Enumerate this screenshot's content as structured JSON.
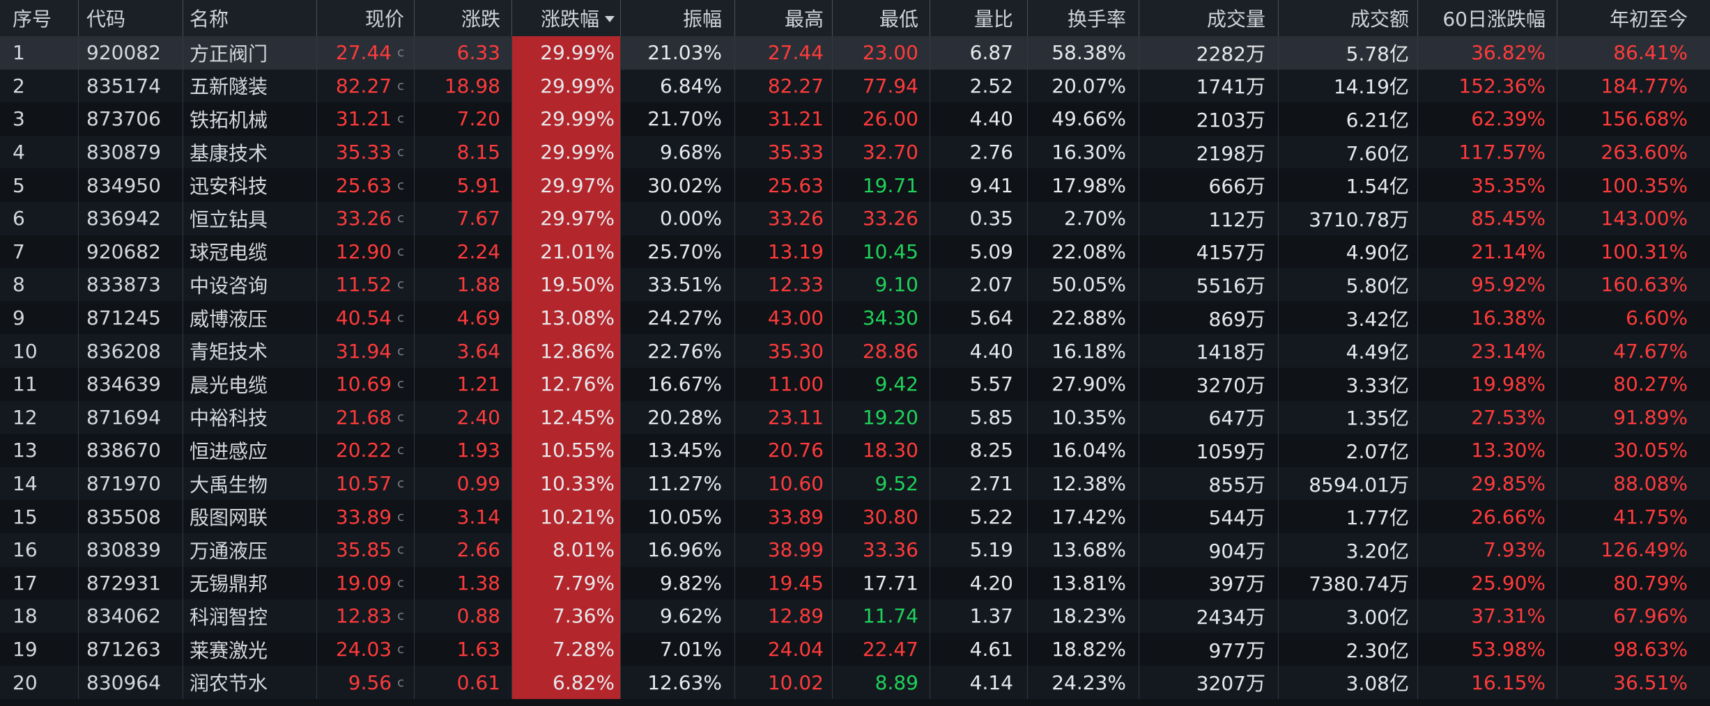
{
  "headers": {
    "seq": "序号",
    "code": "代码",
    "name": "名称",
    "price": "现价",
    "chg": "涨跌",
    "chg_pct": "涨跌幅",
    "amp": "振幅",
    "high": "最高",
    "low": "最低",
    "vol_ratio": "量比",
    "turnover": "换手率",
    "volume": "成交量",
    "amount": "成交额",
    "chg60": "60日涨跌幅",
    "ytd": "年初至今"
  },
  "price_suffix": "c",
  "colors": {
    "up": "#ff3b3b",
    "down": "#1fd35a",
    "neutral": "#e7e9ec",
    "pct_bg": "#b3262c"
  },
  "rows": [
    {
      "seq": "1",
      "code": "920082",
      "name": "方正阀门",
      "price": "27.44",
      "chg": "6.33",
      "chg_pct": "29.99%",
      "amp": "21.03%",
      "high": "27.44",
      "low": "23.00",
      "low_color": "red",
      "vol_ratio": "6.87",
      "turnover": "58.38%",
      "volume": "2282万",
      "amount": "5.78亿",
      "chg60": "36.82%",
      "ytd": "86.41%"
    },
    {
      "seq": "2",
      "code": "835174",
      "name": "五新隧装",
      "price": "82.27",
      "chg": "18.98",
      "chg_pct": "29.99%",
      "amp": "6.84%",
      "high": "82.27",
      "low": "77.94",
      "low_color": "red",
      "vol_ratio": "2.52",
      "turnover": "20.07%",
      "volume": "1741万",
      "amount": "14.19亿",
      "chg60": "152.36%",
      "ytd": "184.77%"
    },
    {
      "seq": "3",
      "code": "873706",
      "name": "铁拓机械",
      "price": "31.21",
      "chg": "7.20",
      "chg_pct": "29.99%",
      "amp": "21.70%",
      "high": "31.21",
      "low": "26.00",
      "low_color": "red",
      "vol_ratio": "4.40",
      "turnover": "49.66%",
      "volume": "2103万",
      "amount": "6.21亿",
      "chg60": "62.39%",
      "ytd": "156.68%"
    },
    {
      "seq": "4",
      "code": "830879",
      "name": "基康技术",
      "price": "35.33",
      "chg": "8.15",
      "chg_pct": "29.99%",
      "amp": "9.68%",
      "high": "35.33",
      "low": "32.70",
      "low_color": "red",
      "vol_ratio": "2.76",
      "turnover": "16.30%",
      "volume": "2198万",
      "amount": "7.60亿",
      "chg60": "117.57%",
      "ytd": "263.60%"
    },
    {
      "seq": "5",
      "code": "834950",
      "name": "迅安科技",
      "price": "25.63",
      "chg": "5.91",
      "chg_pct": "29.97%",
      "amp": "30.02%",
      "high": "25.63",
      "low": "19.71",
      "low_color": "green",
      "vol_ratio": "9.41",
      "turnover": "17.98%",
      "volume": "666万",
      "amount": "1.54亿",
      "chg60": "35.35%",
      "ytd": "100.35%"
    },
    {
      "seq": "6",
      "code": "836942",
      "name": "恒立钻具",
      "price": "33.26",
      "chg": "7.67",
      "chg_pct": "29.97%",
      "amp": "0.00%",
      "high": "33.26",
      "low": "33.26",
      "low_color": "red",
      "vol_ratio": "0.35",
      "turnover": "2.70%",
      "volume": "112万",
      "amount": "3710.78万",
      "chg60": "85.45%",
      "ytd": "143.00%"
    },
    {
      "seq": "7",
      "code": "920682",
      "name": "球冠电缆",
      "price": "12.90",
      "chg": "2.24",
      "chg_pct": "21.01%",
      "amp": "25.70%",
      "high": "13.19",
      "low": "10.45",
      "low_color": "green",
      "vol_ratio": "5.09",
      "turnover": "22.08%",
      "volume": "4157万",
      "amount": "4.90亿",
      "chg60": "21.14%",
      "ytd": "100.31%"
    },
    {
      "seq": "8",
      "code": "833873",
      "name": "中设咨询",
      "price": "11.52",
      "chg": "1.88",
      "chg_pct": "19.50%",
      "amp": "33.51%",
      "high": "12.33",
      "low": "9.10",
      "low_color": "green",
      "vol_ratio": "2.07",
      "turnover": "50.05%",
      "volume": "5516万",
      "amount": "5.80亿",
      "chg60": "95.92%",
      "ytd": "160.63%"
    },
    {
      "seq": "9",
      "code": "871245",
      "name": "威博液压",
      "price": "40.54",
      "chg": "4.69",
      "chg_pct": "13.08%",
      "amp": "24.27%",
      "high": "43.00",
      "low": "34.30",
      "low_color": "green",
      "vol_ratio": "5.64",
      "turnover": "22.88%",
      "volume": "869万",
      "amount": "3.42亿",
      "chg60": "16.38%",
      "ytd": "6.60%"
    },
    {
      "seq": "10",
      "code": "836208",
      "name": "青矩技术",
      "price": "31.94",
      "chg": "3.64",
      "chg_pct": "12.86%",
      "amp": "22.76%",
      "high": "35.30",
      "low": "28.86",
      "low_color": "red",
      "vol_ratio": "4.40",
      "turnover": "16.18%",
      "volume": "1418万",
      "amount": "4.49亿",
      "chg60": "23.14%",
      "ytd": "47.67%"
    },
    {
      "seq": "11",
      "code": "834639",
      "name": "晨光电缆",
      "price": "10.69",
      "chg": "1.21",
      "chg_pct": "12.76%",
      "amp": "16.67%",
      "high": "11.00",
      "low": "9.42",
      "low_color": "green",
      "vol_ratio": "5.57",
      "turnover": "27.90%",
      "volume": "3270万",
      "amount": "3.33亿",
      "chg60": "19.98%",
      "ytd": "80.27%"
    },
    {
      "seq": "12",
      "code": "871694",
      "name": "中裕科技",
      "price": "21.68",
      "chg": "2.40",
      "chg_pct": "12.45%",
      "amp": "20.28%",
      "high": "23.11",
      "low": "19.20",
      "low_color": "green",
      "vol_ratio": "5.85",
      "turnover": "10.35%",
      "volume": "647万",
      "amount": "1.35亿",
      "chg60": "27.53%",
      "ytd": "91.89%"
    },
    {
      "seq": "13",
      "code": "838670",
      "name": "恒进感应",
      "price": "20.22",
      "chg": "1.93",
      "chg_pct": "10.55%",
      "amp": "13.45%",
      "high": "20.76",
      "low": "18.30",
      "low_color": "red",
      "vol_ratio": "8.25",
      "turnover": "16.04%",
      "volume": "1059万",
      "amount": "2.07亿",
      "chg60": "13.30%",
      "ytd": "30.05%"
    },
    {
      "seq": "14",
      "code": "871970",
      "name": "大禹生物",
      "price": "10.57",
      "chg": "0.99",
      "chg_pct": "10.33%",
      "amp": "11.27%",
      "high": "10.60",
      "low": "9.52",
      "low_color": "green",
      "vol_ratio": "2.71",
      "turnover": "12.38%",
      "volume": "855万",
      "amount": "8594.01万",
      "chg60": "29.85%",
      "ytd": "88.08%"
    },
    {
      "seq": "15",
      "code": "835508",
      "name": "殷图网联",
      "price": "33.89",
      "chg": "3.14",
      "chg_pct": "10.21%",
      "amp": "10.05%",
      "high": "33.89",
      "low": "30.80",
      "low_color": "red",
      "vol_ratio": "5.22",
      "turnover": "17.42%",
      "volume": "544万",
      "amount": "1.77亿",
      "chg60": "26.66%",
      "ytd": "41.75%"
    },
    {
      "seq": "16",
      "code": "830839",
      "name": "万通液压",
      "price": "35.85",
      "chg": "2.66",
      "chg_pct": "8.01%",
      "amp": "16.96%",
      "high": "38.99",
      "low": "33.36",
      "low_color": "red",
      "vol_ratio": "5.19",
      "turnover": "13.68%",
      "volume": "904万",
      "amount": "3.20亿",
      "chg60": "7.93%",
      "ytd": "126.49%"
    },
    {
      "seq": "17",
      "code": "872931",
      "name": "无锡鼎邦",
      "price": "19.09",
      "chg": "1.38",
      "chg_pct": "7.79%",
      "amp": "9.82%",
      "high": "19.45",
      "low": "17.71",
      "low_color": "white",
      "vol_ratio": "4.20",
      "turnover": "13.81%",
      "volume": "397万",
      "amount": "7380.74万",
      "chg60": "25.90%",
      "ytd": "80.79%"
    },
    {
      "seq": "18",
      "code": "834062",
      "name": "科润智控",
      "price": "12.83",
      "chg": "0.88",
      "chg_pct": "7.36%",
      "amp": "9.62%",
      "high": "12.89",
      "low": "11.74",
      "low_color": "green",
      "vol_ratio": "1.37",
      "turnover": "18.23%",
      "volume": "2434万",
      "amount": "3.00亿",
      "chg60": "37.31%",
      "ytd": "67.96%"
    },
    {
      "seq": "19",
      "code": "871263",
      "name": "莱赛激光",
      "price": "24.03",
      "chg": "1.63",
      "chg_pct": "7.28%",
      "amp": "7.01%",
      "high": "24.04",
      "low": "22.47",
      "low_color": "red",
      "vol_ratio": "4.61",
      "turnover": "18.82%",
      "volume": "977万",
      "amount": "2.30亿",
      "chg60": "53.98%",
      "ytd": "98.63%"
    },
    {
      "seq": "20",
      "code": "830964",
      "name": "润农节水",
      "price": "9.56",
      "chg": "0.61",
      "chg_pct": "6.82%",
      "amp": "12.63%",
      "high": "10.02",
      "low": "8.89",
      "low_color": "green",
      "vol_ratio": "4.14",
      "turnover": "24.23%",
      "volume": "3207万",
      "amount": "3.08亿",
      "chg60": "16.15%",
      "ytd": "36.51%"
    }
  ]
}
